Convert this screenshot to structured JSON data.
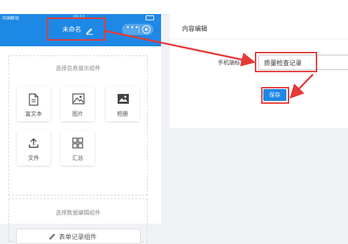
{
  "status_bar": {
    "left": "中国移动",
    "time": "20:52"
  },
  "phone": {
    "title": "未命名",
    "section1_title": "选择信息展示组件",
    "tiles": [
      {
        "label": "富文本",
        "icon": "document-icon"
      },
      {
        "label": "图片",
        "icon": "image-icon"
      },
      {
        "label": "相册",
        "icon": "album-icon"
      },
      {
        "label": "文件",
        "icon": "upload-icon"
      },
      {
        "label": "汇总",
        "icon": "grid-icon"
      }
    ],
    "section2_title": "选择数据编辑组件",
    "form_button": "表单记录组件"
  },
  "editor": {
    "title": "内容编辑",
    "field_label": "手机端标题:",
    "field_value": "质量检查记录",
    "save_label": "保存"
  },
  "colors": {
    "primary": "#1e88e5",
    "highlight": "#e53935"
  }
}
